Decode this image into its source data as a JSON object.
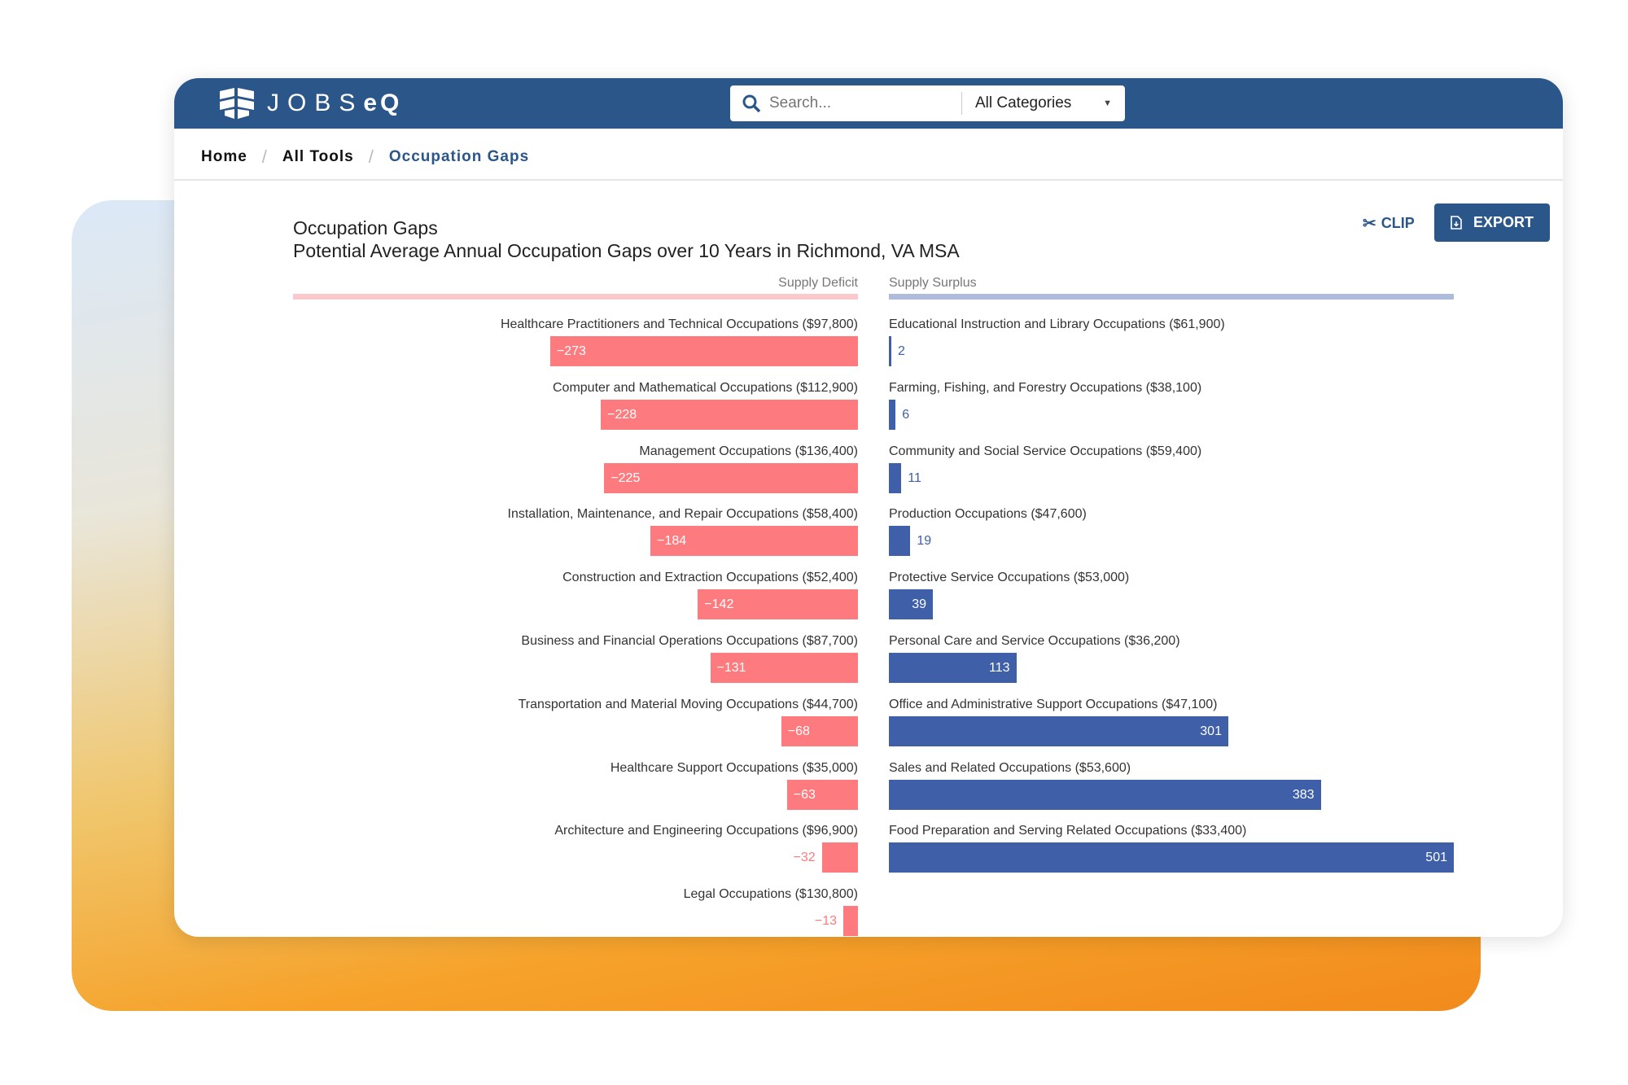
{
  "app": {
    "logo": "JOBSeQ"
  },
  "search": {
    "placeholder": "Search...",
    "category": "All Categories"
  },
  "breadcrumb": [
    "Home",
    "All Tools",
    "Occupation Gaps"
  ],
  "actions": {
    "clip": "CLIP",
    "export": "EXPORT"
  },
  "colors": {
    "header": "#2a5689",
    "deficit": "#fd7b7e",
    "surplus": "#3f60a8",
    "deficit_line": "#fbc9cb",
    "surplus_line": "#aebbdb"
  },
  "chart_data": {
    "type": "bar",
    "title": "Occupation Gaps",
    "subtitle": "Potential Average Annual Occupation Gaps over 10 Years in Richmond, VA MSA",
    "deficit_label": "Supply Deficit",
    "surplus_label": "Supply Surplus",
    "deficit": [
      {
        "label": "Healthcare Practitioners and Technical Occupations ($97,800)",
        "value": -273
      },
      {
        "label": "Computer and Mathematical Occupations ($112,900)",
        "value": -228
      },
      {
        "label": "Management Occupations ($136,400)",
        "value": -225
      },
      {
        "label": "Installation, Maintenance, and Repair Occupations ($58,400)",
        "value": -184
      },
      {
        "label": "Construction and Extraction Occupations ($52,400)",
        "value": -142
      },
      {
        "label": "Business and Financial Operations Occupations ($87,700)",
        "value": -131
      },
      {
        "label": "Transportation and Material Moving Occupations ($44,700)",
        "value": -68
      },
      {
        "label": "Healthcare Support Occupations ($35,000)",
        "value": -63
      },
      {
        "label": "Architecture and Engineering Occupations ($96,900)",
        "value": -32
      },
      {
        "label": "Legal Occupations ($130,800)",
        "value": -13
      }
    ],
    "surplus": [
      {
        "label": "Educational Instruction and Library Occupations ($61,900)",
        "value": 2
      },
      {
        "label": "Farming, Fishing, and Forestry Occupations ($38,100)",
        "value": 6
      },
      {
        "label": "Community and Social Service Occupations ($59,400)",
        "value": 11
      },
      {
        "label": "Production Occupations ($47,600)",
        "value": 19
      },
      {
        "label": "Protective Service Occupations ($53,000)",
        "value": 39
      },
      {
        "label": "Personal Care and Service Occupations ($36,200)",
        "value": 113
      },
      {
        "label": "Office and Administrative Support Occupations ($47,100)",
        "value": 301
      },
      {
        "label": "Sales and Related Occupations ($53,600)",
        "value": 383
      },
      {
        "label": "Food Preparation and Serving Related Occupations ($33,400)",
        "value": 501
      }
    ]
  }
}
